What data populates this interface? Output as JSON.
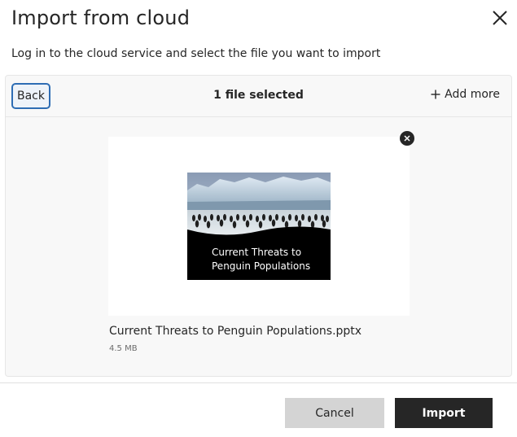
{
  "dialog": {
    "title": "Import from cloud",
    "subtitle": "Log in to the cloud service and select the file you want to import",
    "close_icon": "close-icon"
  },
  "panel": {
    "back_label": "Back",
    "selected_count": "1 file selected",
    "add_more_label": "Add more",
    "add_icon": "plus-icon"
  },
  "file": {
    "name": "Current Threats to Penguin Populations.pptx",
    "size": "4.5 MB",
    "thumbnail_caption": "Current Threats to Penguin Populations",
    "remove_icon": "close-circle-icon"
  },
  "footer": {
    "cancel_label": "Cancel",
    "import_label": "Import"
  },
  "colors": {
    "accent": "#2e6db4",
    "primary_button": "#262626",
    "secondary_button": "#d4d4d4"
  }
}
